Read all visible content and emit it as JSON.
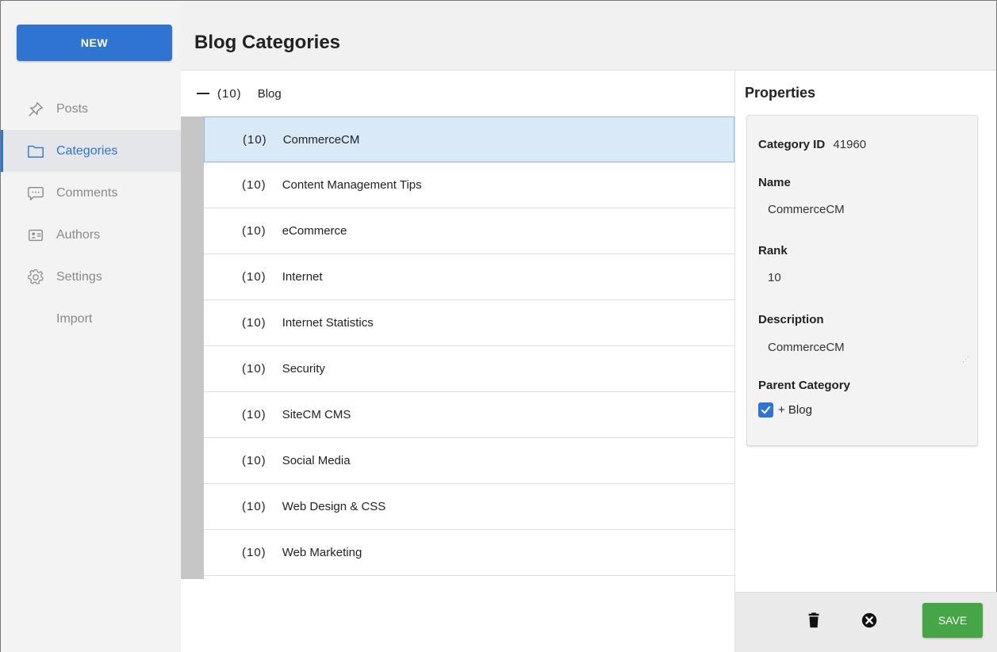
{
  "sidebar": {
    "new_label": "NEW",
    "items": [
      {
        "label": "Posts",
        "icon": "pin-icon",
        "active": false
      },
      {
        "label": "Categories",
        "icon": "folder-icon",
        "active": true
      },
      {
        "label": "Comments",
        "icon": "comment-icon",
        "active": false
      },
      {
        "label": "Authors",
        "icon": "id-card-icon",
        "active": false
      },
      {
        "label": "Settings",
        "icon": "gear-icon",
        "active": false
      },
      {
        "label": "Import",
        "icon": "",
        "active": false
      }
    ]
  },
  "header": {
    "title": "Blog Categories"
  },
  "tree": {
    "root": {
      "count": "(10)",
      "label": "Blog"
    },
    "rows": [
      {
        "count": "(10)",
        "label": "CommerceCM",
        "selected": true
      },
      {
        "count": "(10)",
        "label": "Content Management Tips"
      },
      {
        "count": "(10)",
        "label": "eCommerce"
      },
      {
        "count": "(10)",
        "label": "Internet"
      },
      {
        "count": "(10)",
        "label": "Internet Statistics"
      },
      {
        "count": "(10)",
        "label": "Security"
      },
      {
        "count": "(10)",
        "label": "SiteCM CMS"
      },
      {
        "count": "(10)",
        "label": "Social Media"
      },
      {
        "count": "(10)",
        "label": "Web Design & CSS"
      },
      {
        "count": "(10)",
        "label": "Web Marketing"
      }
    ]
  },
  "properties": {
    "title": "Properties",
    "category_id_label": "Category ID",
    "category_id": "41960",
    "name_label": "Name",
    "name": "CommerceCM",
    "rank_label": "Rank",
    "rank": "10",
    "description_label": "Description",
    "description": "CommerceCM",
    "parent_label": "Parent Category",
    "parent_value": "+ Blog",
    "parent_checked": true,
    "save_label": "SAVE"
  },
  "colors": {
    "accent": "#2f74d0",
    "save": "#46a546",
    "selected_row": "#d9e9f8"
  }
}
